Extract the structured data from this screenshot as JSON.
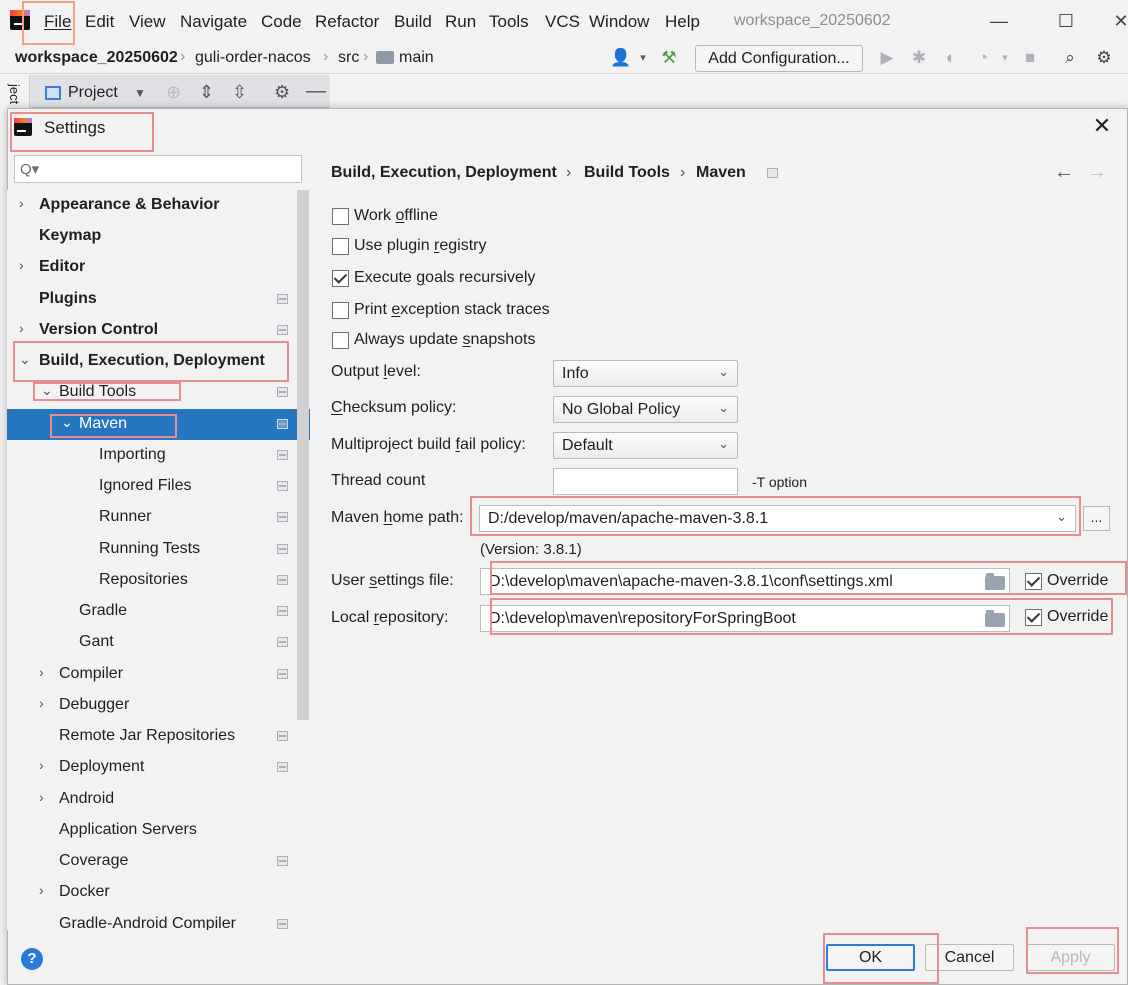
{
  "menubar": {
    "items": [
      "File",
      "Edit",
      "View",
      "Navigate",
      "Code",
      "Refactor",
      "Build",
      "Run",
      "Tools",
      "VCS",
      "Window",
      "Help"
    ],
    "window_title": "workspace_20250602",
    "controls": [
      "—",
      "☐",
      "✕"
    ]
  },
  "navbar": {
    "crumbs": [
      "workspace_20250602",
      "guli-order-nacos",
      "src",
      "main"
    ],
    "add_configuration": "Add Configuration..."
  },
  "project_panel": {
    "title": "Project",
    "side_label": "ject"
  },
  "dialog": {
    "title": "Settings",
    "search_placeholder": "Q▾",
    "tree": [
      {
        "label": "Appearance & Behavior",
        "bold": true,
        "chevron": "›"
      },
      {
        "label": "Keymap",
        "bold": true,
        "chevron": ""
      },
      {
        "label": "Editor",
        "bold": true,
        "chevron": "›"
      },
      {
        "label": "Plugins",
        "bold": true,
        "chevron": "",
        "page": true
      },
      {
        "label": "Version Control",
        "bold": true,
        "chevron": "›",
        "page": true
      },
      {
        "label": "Build, Execution, Deployment",
        "bold": true,
        "chevron": "⌄"
      },
      {
        "label": "Build Tools",
        "bold": false,
        "chevron": "⌄",
        "page": true
      },
      {
        "label": "Maven",
        "bold": false,
        "chevron": "⌄",
        "page": true,
        "selected": true
      },
      {
        "label": "Importing",
        "bold": false,
        "chevron": "",
        "page": true
      },
      {
        "label": "Ignored Files",
        "bold": false,
        "chevron": "",
        "page": true
      },
      {
        "label": "Runner",
        "bold": false,
        "chevron": "",
        "page": true
      },
      {
        "label": "Running Tests",
        "bold": false,
        "chevron": "",
        "page": true
      },
      {
        "label": "Repositories",
        "bold": false,
        "chevron": "",
        "page": true
      },
      {
        "label": "Gradle",
        "bold": false,
        "chevron": "",
        "page": true
      },
      {
        "label": "Gant",
        "bold": false,
        "chevron": "",
        "page": true
      },
      {
        "label": "Compiler",
        "bold": false,
        "chevron": "›",
        "page": true
      },
      {
        "label": "Debugger",
        "bold": false,
        "chevron": "›"
      },
      {
        "label": "Remote Jar Repositories",
        "bold": false,
        "chevron": "",
        "page": true
      },
      {
        "label": "Deployment",
        "bold": false,
        "chevron": "›",
        "page": true
      },
      {
        "label": "Android",
        "bold": false,
        "chevron": "›"
      },
      {
        "label": "Application Servers",
        "bold": false,
        "chevron": ""
      },
      {
        "label": "Coverage",
        "bold": false,
        "chevron": "",
        "page": true
      },
      {
        "label": "Docker",
        "bold": false,
        "chevron": "›"
      },
      {
        "label": "Gradle-Android Compiler",
        "bold": false,
        "chevron": "",
        "page": true
      }
    ],
    "breadcrumb": [
      "Build, Execution, Deployment",
      "Build Tools",
      "Maven"
    ],
    "checkboxes": [
      {
        "label": "Work offline",
        "checked": false
      },
      {
        "label": "Use plugin registry",
        "checked": false
      },
      {
        "label": "Execute goals recursively",
        "checked": true
      },
      {
        "label": "Print exception stack traces",
        "checked": false
      },
      {
        "label": "Always update snapshots",
        "checked": false
      }
    ],
    "output_level": {
      "label": "Output level:",
      "value": "Info"
    },
    "checksum_policy": {
      "label": "Checksum policy:",
      "value": "No Global Policy"
    },
    "fail_policy": {
      "label": "Multiproject build fail policy:",
      "value": "Default"
    },
    "thread_count": {
      "label": "Thread count",
      "value": "",
      "note": "-T option"
    },
    "maven_home": {
      "label": "Maven home path:",
      "value": "D:/develop/maven/apache-maven-3.8.1",
      "version": "(Version: 3.8.1)",
      "browse": "..."
    },
    "user_settings": {
      "label": "User settings file:",
      "value": "D:\\develop\\maven\\apache-maven-3.8.1\\conf\\settings.xml",
      "override": "Override",
      "override_checked": true
    },
    "local_repo": {
      "label": "Local repository:",
      "value": "D:\\develop\\maven\\repositoryForSpringBoot",
      "override": "Override",
      "override_checked": true
    },
    "buttons": {
      "ok": "OK",
      "cancel": "Cancel",
      "apply": "Apply",
      "help": "?"
    }
  },
  "colors": {
    "selection": "#2675bf",
    "annotation": "#e58d92",
    "ok_border": "#2f7bd8"
  }
}
